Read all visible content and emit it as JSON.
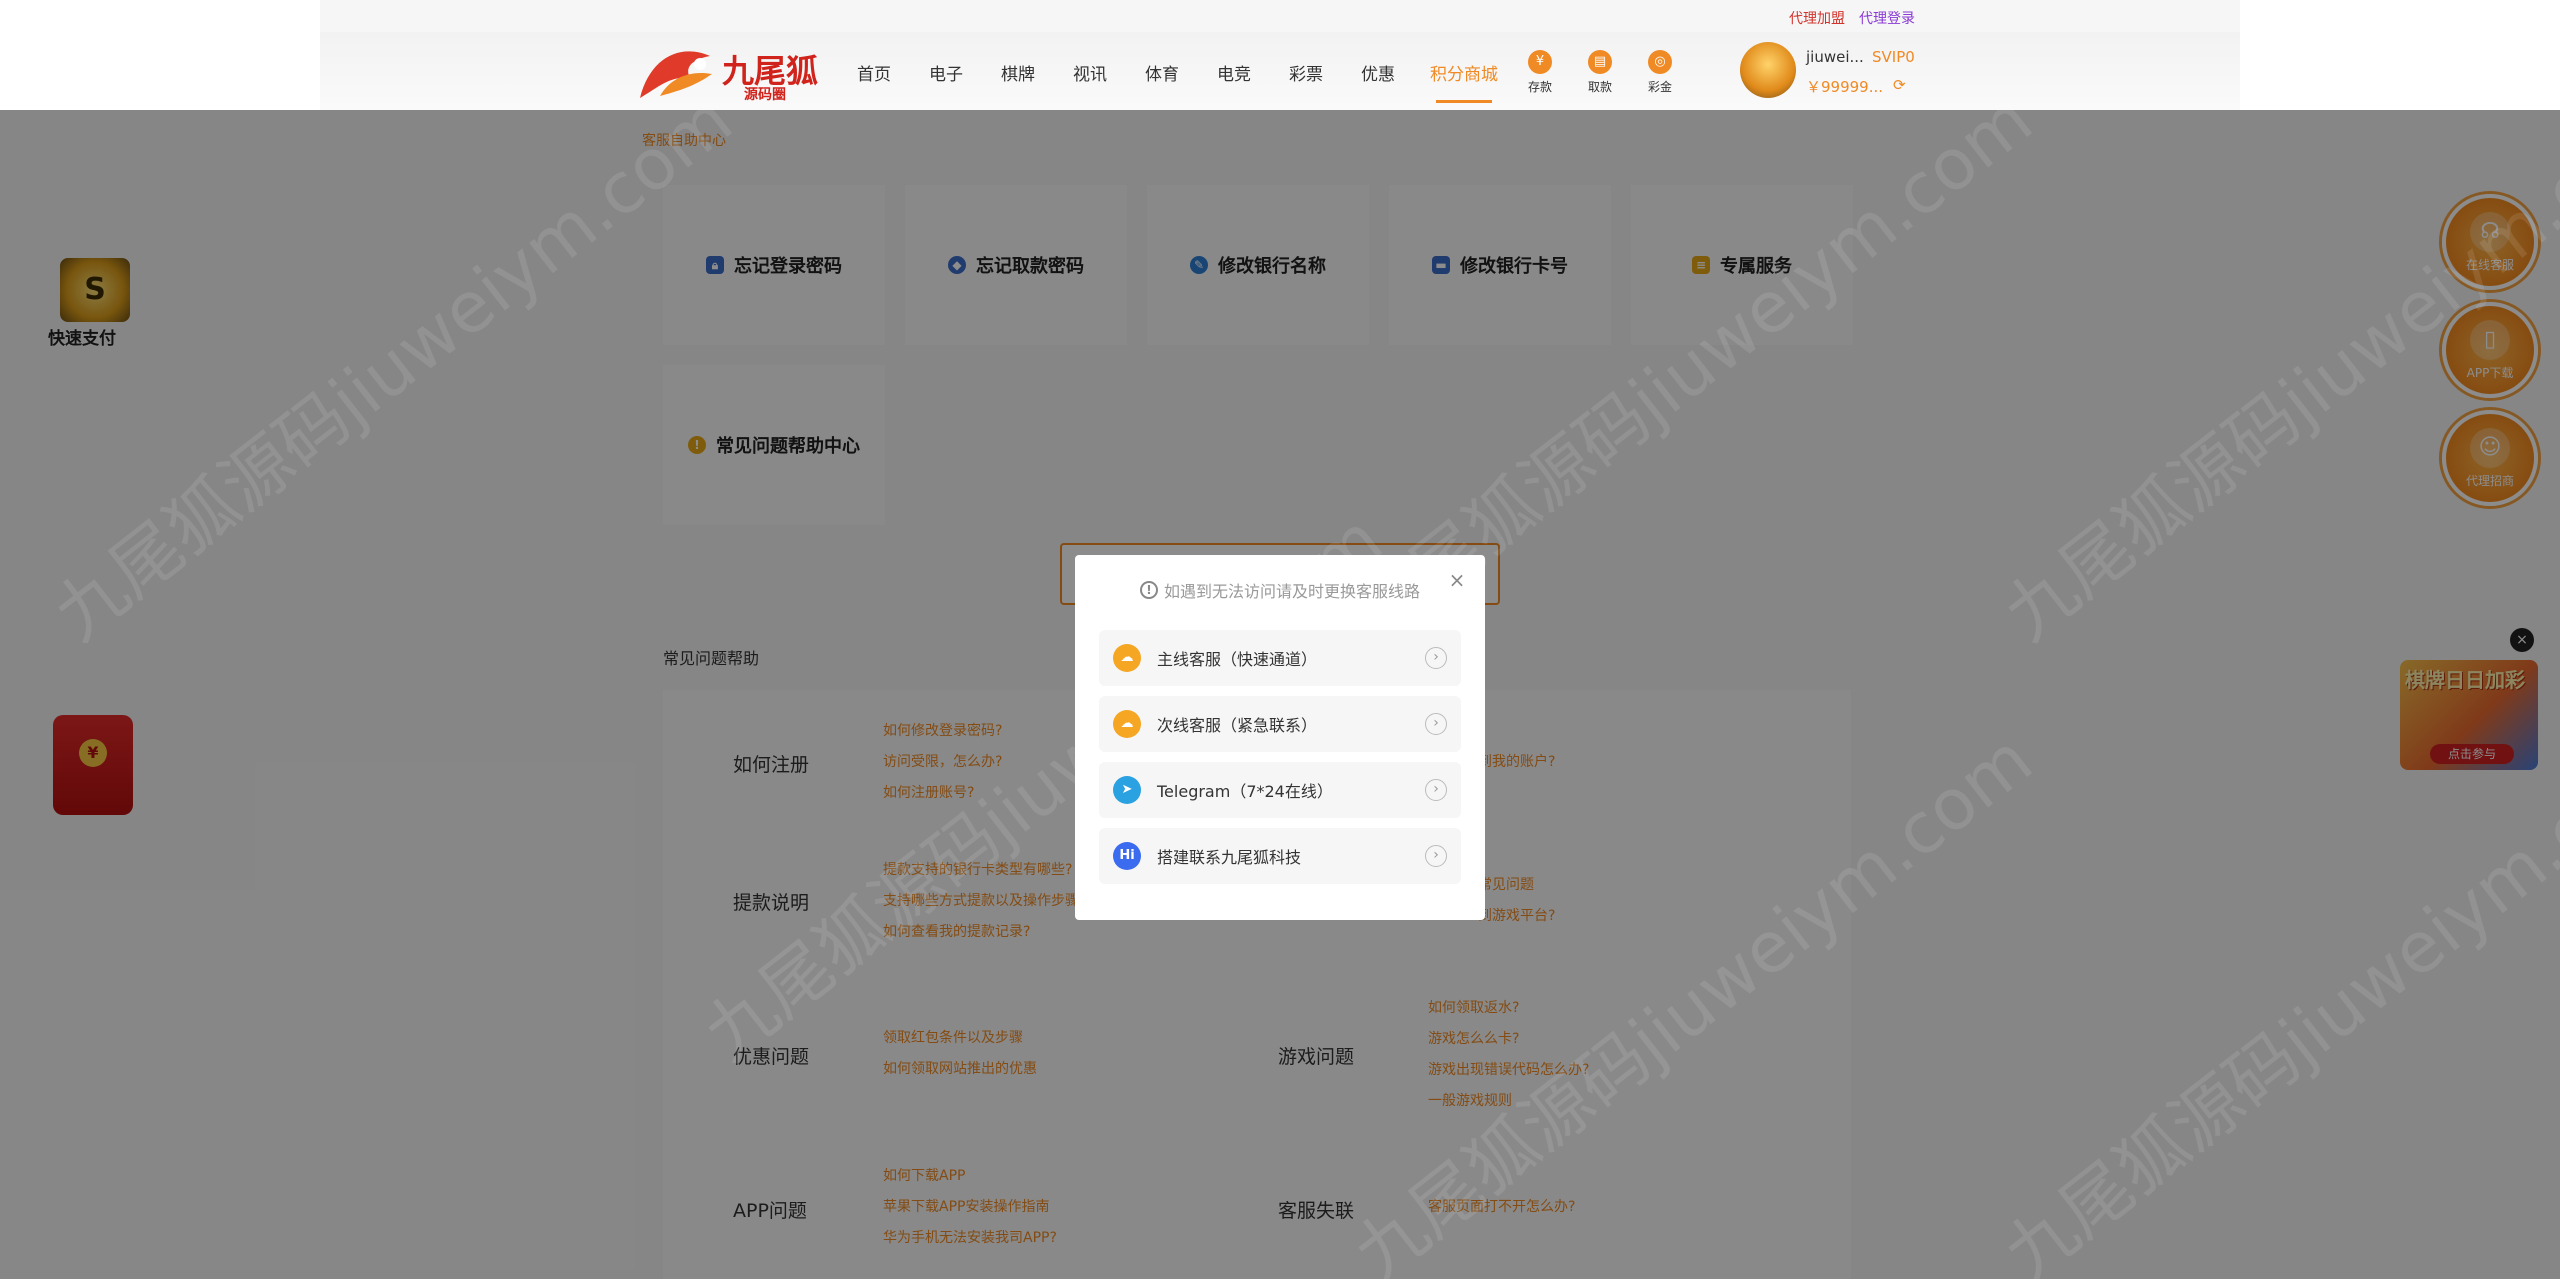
{
  "header": {
    "top_links": [
      "代理加盟",
      "代理登录"
    ],
    "logo_text": "九尾狐",
    "logo_sub": "源码圈",
    "nav": [
      "首页",
      "电子",
      "棋牌",
      "视讯",
      "体育",
      "电竞",
      "彩票",
      "优惠",
      "积分商城"
    ],
    "quick": [
      {
        "label": "存款",
        "icon": "piggy-bank-icon"
      },
      {
        "label": "取款",
        "icon": "wallet-icon"
      },
      {
        "label": "彩金",
        "icon": "gift-coin-icon"
      }
    ],
    "user": {
      "name": "jiuwei...",
      "vip": "SVIP0",
      "balance": "￥99999..."
    }
  },
  "breadcrumb": "客服自助中心",
  "service_cards": [
    {
      "label": "忘记登录密码",
      "icon": "lock-icon",
      "color": "#3b6cc9"
    },
    {
      "label": "忘记取款密码",
      "icon": "shield-icon",
      "color": "#3b6cc9"
    },
    {
      "label": "修改银行名称",
      "icon": "edit-icon",
      "color": "#2f7fd6"
    },
    {
      "label": "修改银行卡号",
      "icon": "card-icon",
      "color": "#3b6cc9"
    },
    {
      "label": "专属服务",
      "icon": "document-icon",
      "color": "#e6a817"
    },
    {
      "label": "常见问题帮助中心",
      "icon": "lightbulb-icon",
      "color": "#e6a817"
    }
  ],
  "faq": {
    "title": "常见问题帮助",
    "categories": [
      {
        "name": "如何注册",
        "questions": [
          "如何修改登录密码?",
          "访问受限，怎么办?",
          "如何注册账号?"
        ]
      },
      {
        "name": "提款说明",
        "questions": [
          "提款支持的银行卡类型有哪些?",
          "支持哪些方式提款以及操作步骤",
          "如何查看我的提款记录?"
        ]
      },
      {
        "name": "优惠问题",
        "questions": [
          "领取红包条件以及步骤",
          "如何领取网站推出的优惠"
        ]
      },
      {
        "name": "APP问题",
        "questions": [
          "如何下载APP",
          "苹果下载APP安装操作指南",
          "华为手机无法安装我司APP?"
        ]
      }
    ],
    "right_categories": [
      {
        "name": "",
        "questions": [
          "到我的账户?"
        ]
      },
      {
        "name": "",
        "questions": [
          "常见问题",
          "到游戏平台?"
        ]
      },
      {
        "name": "游戏问题",
        "questions": [
          "如何领取返水?",
          "游戏怎么么卡?",
          "游戏出现错误代码怎么办?",
          "一般游戏规则"
        ]
      },
      {
        "name": "客服失联",
        "questions": [
          "客服页面打不开怎么办?"
        ]
      }
    ]
  },
  "modal": {
    "notice": "如遇到无法访问请及时更换客服线路",
    "close": "×",
    "rows": [
      {
        "label": "主线客服（快速通道）",
        "icon": "support-cloud-icon",
        "color": "#f5a623"
      },
      {
        "label": "次线客服（紧急联系）",
        "icon": "support-cloud-icon",
        "color": "#f5a623"
      },
      {
        "label": "Telegram（7*24在线）",
        "icon": "telegram-icon",
        "color": "#2aa1e0"
      },
      {
        "label": "搭建联系九尾狐科技",
        "icon": "chat-hi-icon",
        "color": "#3b6cf0"
      }
    ]
  },
  "floating": {
    "right": [
      "在线客服",
      "APP下载",
      "代理招商"
    ],
    "ad": {
      "title": "棋牌日日加彩",
      "button": "点击参与"
    },
    "pay": "快速支付"
  },
  "watermark": "九尾狐源码jiuweiym.com"
}
